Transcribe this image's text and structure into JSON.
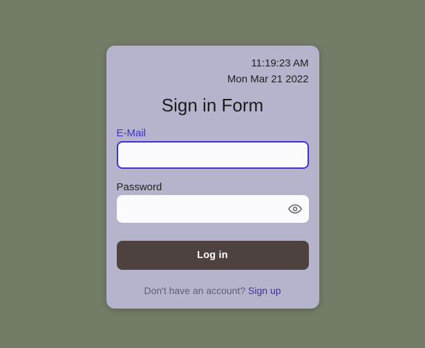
{
  "header": {
    "time": "11:19:23 AM",
    "date": "Mon Mar 21 2022"
  },
  "title": "Sign in Form",
  "form": {
    "email": {
      "label": "E-Mail",
      "value": "",
      "focused": true
    },
    "password": {
      "label": "Password",
      "value": "",
      "focused": false
    },
    "submit_label": "Log in"
  },
  "footer": {
    "prompt": "Don't have an account? ",
    "link_label": "Sign up"
  },
  "colors": {
    "page_bg": "#727c66",
    "card_bg": "#b5b4cc",
    "focus": "#3b2fd8",
    "button_bg": "#4d423f",
    "link": "#3f3192"
  }
}
